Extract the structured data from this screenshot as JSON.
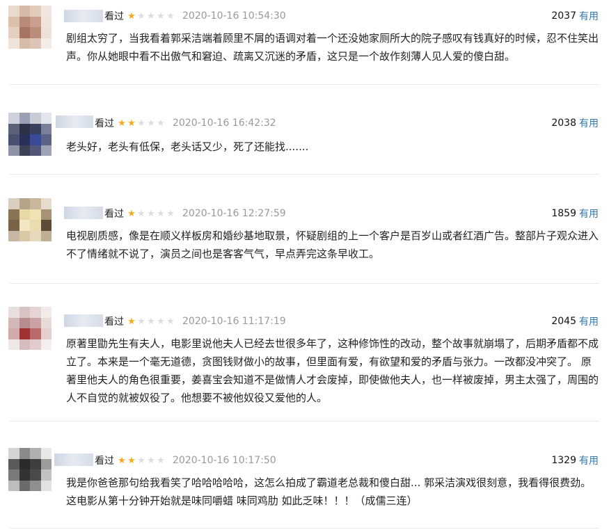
{
  "comments": [
    {
      "status": "看过",
      "rating": 1,
      "time": "2020-10-16 10:54:30",
      "votes": "2037",
      "useful_label": "有用",
      "text": "剧组太穷了，当我看着郭采洁端着顾里不屑的语调对着一个还没她家厕所大的院子感叹有钱真好的时候，忍不住笑出声。你从她眼中看不出傲气和窘迫、疏离又沉迷的矛盾，这只是一个故作刻薄人见人爱的傻白甜。"
    },
    {
      "status": "看过",
      "rating": 2,
      "time": "2020-10-16 16:42:32",
      "votes": "2038",
      "useful_label": "有用",
      "text": "老头好，老头有低保，老头话又少，死了还能找......."
    },
    {
      "status": "看过",
      "rating": 1,
      "time": "2020-10-16 12:27:59",
      "votes": "1859",
      "useful_label": "有用",
      "text": "电视剧质感，像是在顺义样板房和婚纱基地取景，怀疑剧组的上一个客户是百岁山或者红酒广告。整部片子观众进入不了情绪就不说了，演员之间也是客客气气，早点弄完这条早收工。"
    },
    {
      "status": "看过",
      "rating": 1,
      "time": "2020-10-16 11:17:19",
      "votes": "2045",
      "useful_label": "有用",
      "text": "原著里勖先生有夫人，电影里说他夫人已经去世很多年了，这种修饰性的改动，整个故事就崩塌了，后期矛盾都不成立了。本来是一个毫无道德，贪图钱财做小的故事，但里面有爱，有欲望和爱的矛盾与张力。一改都没冲突了。 原著里他夫人的角色很重要，姜喜宝会知道不是做情人才会废掉，即使做他夫人，也一样被废掉，男主太强了，周围的人不自觉的就被奴役了。他想要不被他奴役又爱他的人。"
    },
    {
      "status": "看过",
      "rating": 2,
      "time": "2020-10-16 10:17:50",
      "votes": "1329",
      "useful_label": "有用",
      "text": "我是你爸爸那句给我看笑了哈哈哈哈哈，这怎么拍成了霸道老总裁和傻白甜... 郭采洁演戏很刻意，我看得很费劲。这电影从第十分钟开始就是味同嚼蜡 味同鸡肋 如此乏味！！！（成儒三连）"
    }
  ]
}
